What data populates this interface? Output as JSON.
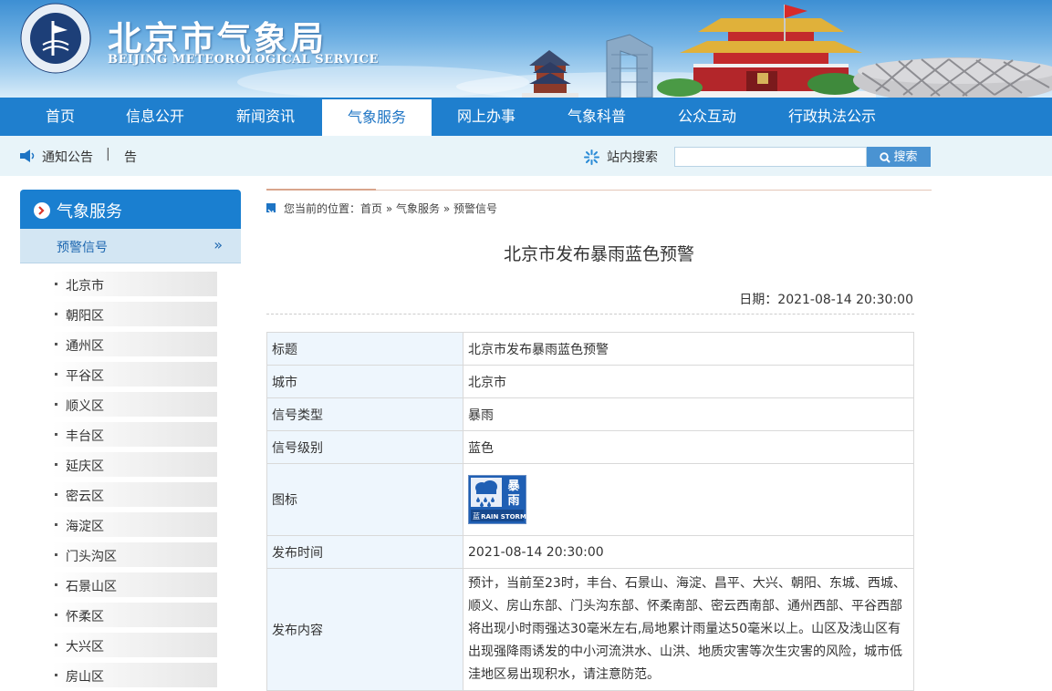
{
  "header": {
    "logo_cn": "北京市气象局",
    "logo_en": "BEIJING METEOROLOGICAL SERVICE",
    "seal_text_top": "BEIJING METEOROLOGICAL SERVICE",
    "seal_text_bottom": "北京市气象局"
  },
  "nav": {
    "items": [
      {
        "label": "首页"
      },
      {
        "label": "信息公开"
      },
      {
        "label": "新闻资讯"
      },
      {
        "label": "气象服务",
        "active": true
      },
      {
        "label": "网上办事"
      },
      {
        "label": "气象科普"
      },
      {
        "label": "公众互动"
      },
      {
        "label": "行政执法公示"
      }
    ]
  },
  "notice": {
    "label": "通知公告",
    "separator": "|",
    "text": "告"
  },
  "search": {
    "label": "站内搜索",
    "value": "",
    "placeholder": "",
    "button": "搜索"
  },
  "sidebar": {
    "title": "气象服务",
    "current": "预警信号",
    "arrow": "»",
    "items": [
      {
        "label": "北京市"
      },
      {
        "label": "朝阳区"
      },
      {
        "label": "通州区"
      },
      {
        "label": "平谷区"
      },
      {
        "label": "顺义区"
      },
      {
        "label": "丰台区"
      },
      {
        "label": "延庆区"
      },
      {
        "label": "密云区"
      },
      {
        "label": "海淀区"
      },
      {
        "label": "门头沟区"
      },
      {
        "label": "石景山区"
      },
      {
        "label": "怀柔区"
      },
      {
        "label": "大兴区"
      },
      {
        "label": "房山区"
      }
    ]
  },
  "breadcrumb": {
    "prefix": "您当前的位置：",
    "items": [
      "首页",
      "气象服务",
      "预警信号"
    ],
    "separator": " » "
  },
  "article": {
    "title": "北京市发布暴雨蓝色预警",
    "date_label": "日期：",
    "date": "2021-08-14 20:30:00"
  },
  "table": {
    "rows": [
      {
        "key": "标题",
        "value": "北京市发布暴雨蓝色预警"
      },
      {
        "key": "城市",
        "value": "北京市"
      },
      {
        "key": "信号类型",
        "value": "暴雨"
      },
      {
        "key": "信号级别",
        "value": "蓝色"
      },
      {
        "key": "图标",
        "value": ""
      },
      {
        "key": "发布时间",
        "value": "2021-08-14 20:30:00"
      },
      {
        "key": "发布内容",
        "value": "预计，当前至23时，丰台、石景山、海淀、昌平、大兴、朝阳、东城、西城、顺义、房山东部、门头沟东部、怀柔南部、密云西南部、通州西部、平谷西部将出现小时雨强达30毫米左右,局地累计雨量达50毫米以上。山区及浅山区有出现强降雨诱发的中小河流洪水、山洪、地质灾害等次生灾害的风险，城市低洼地区易出现积水，请注意防范。"
      }
    ]
  },
  "warning_icon": {
    "char_top": "暴",
    "char_bottom": "雨",
    "level_char": "蓝",
    "english": "RAIN STORM",
    "color": "#1f5fb4"
  },
  "colors": {
    "nav_bg": "#1f7fce",
    "sidebar_head": "#1a7fd0",
    "subbar_bg": "#e8f4f9",
    "table_key_bg": "#eef6fd"
  }
}
